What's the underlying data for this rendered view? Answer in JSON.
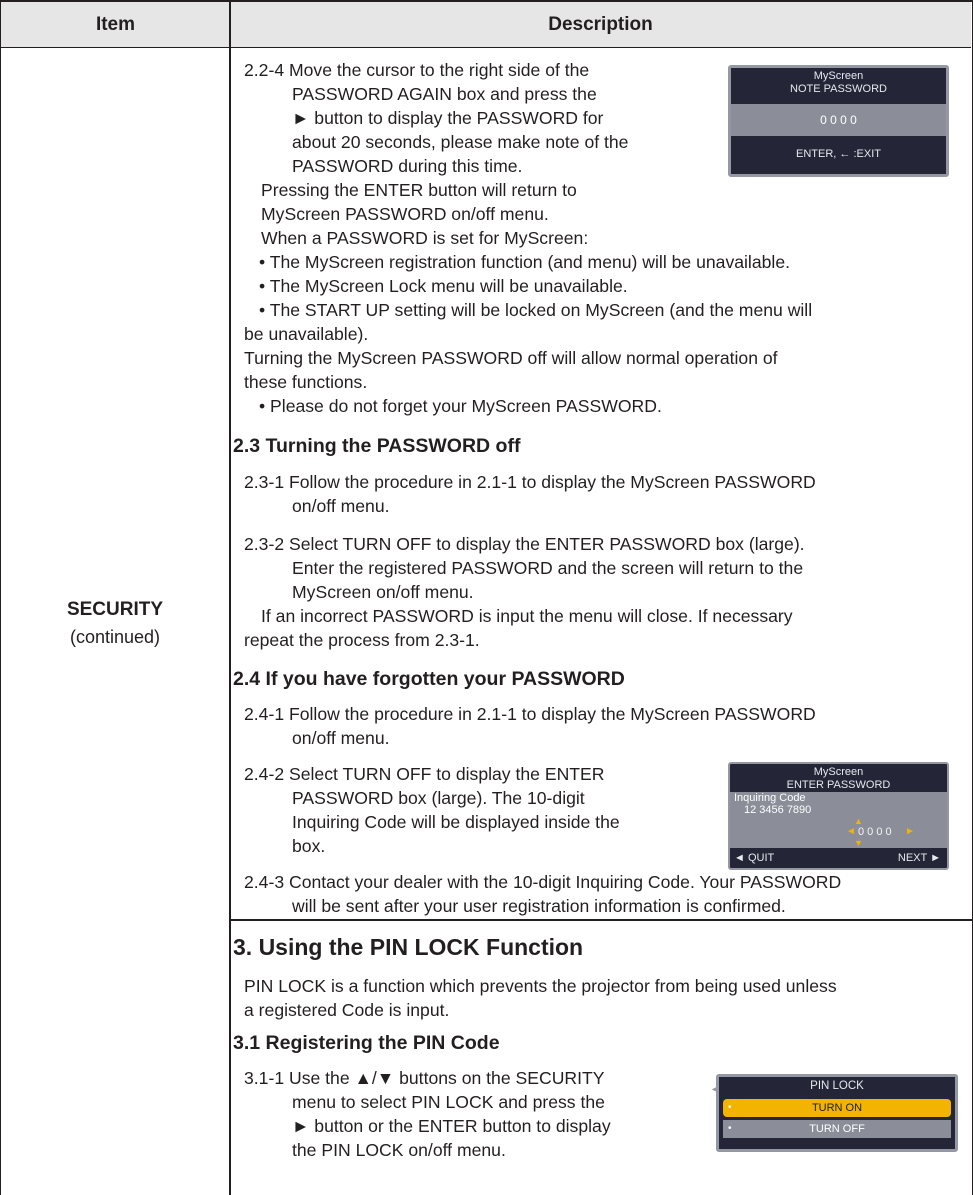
{
  "header": {
    "item": "Item",
    "description": "Description"
  },
  "row_label": {
    "title": "SECURITY",
    "subtitle": "(continued)"
  },
  "p224": {
    "lines": [
      "2.2-4 Move the cursor to the right side of the",
      "PASSWORD AGAIN box and press the",
      "► button to display the PASSWORD for",
      "about 20 seconds, please make note of the",
      "PASSWORD during this time."
    ]
  },
  "osd_note": {
    "line1": "MyScreen",
    "line2": "NOTE PASSWORD",
    "code": "0 0 0 0",
    "footer": "ENTER, ← :EXIT"
  },
  "p224b": {
    "lines": [
      "Pressing the ENTER button will return to",
      "MyScreen PASSWORD on/off menu.",
      "When a PASSWORD is set for MyScreen:"
    ]
  },
  "bullets": {
    "b1": "• The MyScreen registration function (and menu) will be unavailable.",
    "b2": "• The MyScreen Lock menu will be unavailable.",
    "b3a": "• The START UP setting will be locked on MyScreen (and the menu will",
    "b3b": "be unavailable).",
    "turn_a": "Turning the MyScreen PASSWORD off will allow normal operation of",
    "turn_b": "these functions.",
    "b4": "• Please do not forget your MyScreen PASSWORD."
  },
  "s23": {
    "heading": "2.3 Turning the PASSWORD off",
    "p1a": "2.3-1 Follow the procedure in 2.1-1 to display the MyScreen PASSWORD",
    "p1b": "on/off menu.",
    "p2a": "2.3-2 Select TURN OFF to display the ENTER PASSWORD box (large).",
    "p2b": "Enter the registered PASSWORD and the screen will return to the",
    "p2c": "MyScreen on/off menu.",
    "p3a": "If an incorrect PASSWORD is input the menu will close. If necessary",
    "p3b": "repeat the process from 2.3-1."
  },
  "s24": {
    "heading": "2.4 If you have forgotten your PASSWORD",
    "p1a": "2.4-1 Follow the procedure in 2.1-1 to display the MyScreen PASSWORD",
    "p1b": "on/off menu.",
    "p2a": "2.4-2 Select TURN OFF to display the ENTER",
    "p2b": "PASSWORD box (large). The 10-digit",
    "p2c": "Inquiring Code will be displayed inside the",
    "p2d": "box.",
    "p3a": "2.4-3 Contact your dealer with the 10-digit Inquiring Code. Your PASSWORD",
    "p3b": "will be sent after your user registration information is confirmed."
  },
  "osd_enter": {
    "line1": "MyScreen",
    "line2": "ENTER PASSWORD",
    "inq_label": "Inquiring Code",
    "inq_code": "12 3456 7890",
    "code": "0 0 0 0",
    "quit": "◄ QUIT",
    "next": "NEXT ►"
  },
  "s3": {
    "heading": "3. Using the PIN LOCK Function",
    "p1a": "PIN LOCK is a function which prevents the projector from being used unless",
    "p1b": "a registered Code is input.",
    "sub": "3.1 Registering the PIN Code",
    "p2a": "3.1-1 Use the ▲/▼ buttons on the SECURITY",
    "p2b": "menu to select PIN LOCK and press the",
    "p2c": "► button or the ENTER button to display",
    "p2d": "the PIN LOCK on/off menu."
  },
  "osd_pin": {
    "title": "PIN LOCK",
    "on": "TURN ON",
    "off": "TURN OFF"
  }
}
